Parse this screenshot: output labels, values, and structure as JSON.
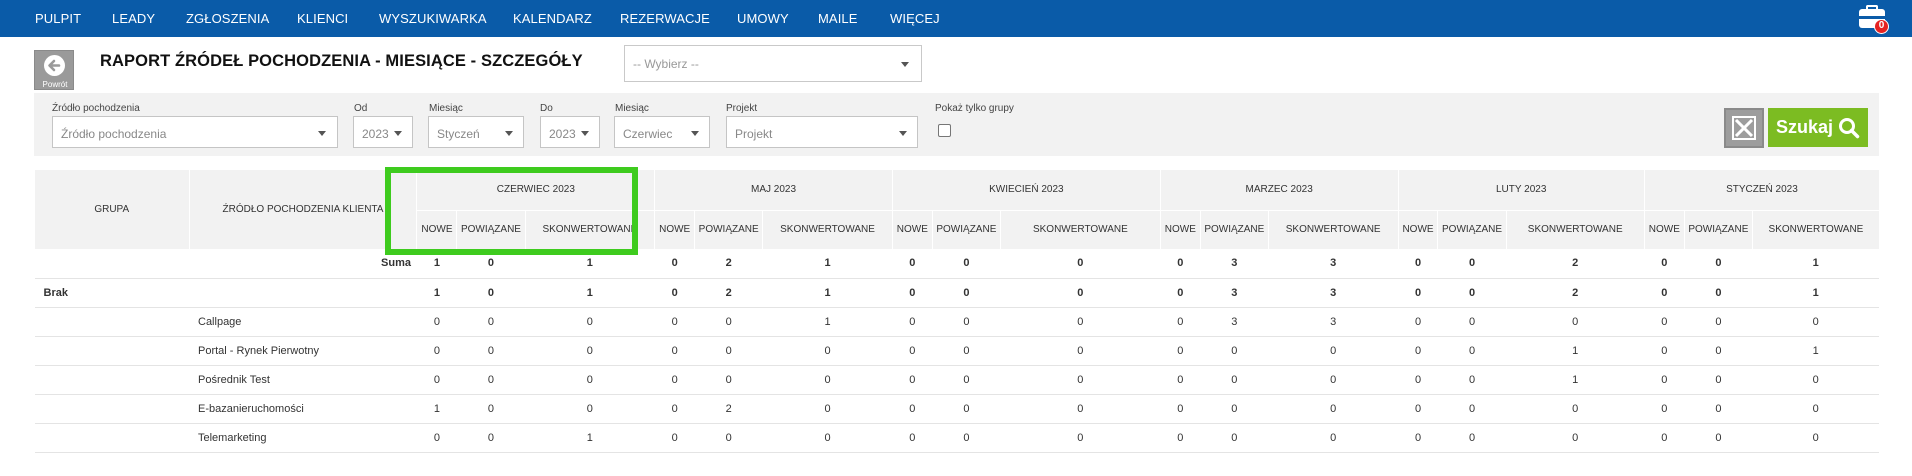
{
  "nav": {
    "items": [
      "PULPIT",
      "LEADY",
      "ZGŁOSZENIA",
      "KLIENCI",
      "WYSZUKIWARKA",
      "KALENDARZ",
      "REZERWACJE",
      "UMOWY",
      "MAILE",
      "WIĘCEJ"
    ],
    "bag_icon": "briefcase-icon",
    "bag_badge": "0"
  },
  "header": {
    "back_label": "Powrót",
    "title": "RAPORT ŹRÓDEŁ POCHODZENIA - MIESIĄCE - SZCZEGÓŁY",
    "select_placeholder": "-- Wybierz --"
  },
  "filters": {
    "source": {
      "label": "Źródło pochodzenia",
      "value": "Źródło pochodzenia"
    },
    "from_year": {
      "label": "Od",
      "value": "2023"
    },
    "from_month": {
      "label": "Miesiąc",
      "value": "Styczeń"
    },
    "to_year": {
      "label": "Do",
      "value": "2023"
    },
    "to_month": {
      "label": "Miesiąc",
      "value": "Czerwiec"
    },
    "project": {
      "label": "Projekt",
      "value": "Projekt"
    },
    "groups_only": {
      "label": "Pokaż tylko grupy",
      "checked": false
    },
    "search_label": "Szukaj"
  },
  "table": {
    "col_group": "GRUPA",
    "col_source": "ŹRÓDŁO POCHODZENIA KLIENTA",
    "months": [
      "CZERWIEC 2023",
      "MAJ 2023",
      "KWIECIEŃ 2023",
      "MARZEC 2023",
      "LUTY 2023",
      "STYCZEŃ 2023"
    ],
    "sub": [
      "NOWE",
      "POWIĄZANE",
      "SKONWERTOWANE"
    ],
    "rows": [
      {
        "type": "sum",
        "group": "",
        "source": "Suma",
        "values": [
          "1",
          "0",
          "1",
          "0",
          "2",
          "1",
          "0",
          "0",
          "0",
          "0",
          "3",
          "3",
          "0",
          "0",
          "2",
          "0",
          "0",
          "1"
        ]
      },
      {
        "type": "group",
        "group": "Brak",
        "source": "",
        "values": [
          "1",
          "0",
          "1",
          "0",
          "2",
          "1",
          "0",
          "0",
          "0",
          "0",
          "3",
          "3",
          "0",
          "0",
          "2",
          "0",
          "0",
          "1"
        ]
      },
      {
        "type": "item",
        "group": "",
        "source": "Callpage",
        "values": [
          "0",
          "0",
          "0",
          "0",
          "0",
          "1",
          "0",
          "0",
          "0",
          "0",
          "3",
          "3",
          "0",
          "0",
          "0",
          "0",
          "0",
          "0"
        ]
      },
      {
        "type": "item",
        "group": "",
        "source": "Portal - Rynek Pierwotny",
        "values": [
          "0",
          "0",
          "0",
          "0",
          "0",
          "0",
          "0",
          "0",
          "0",
          "0",
          "0",
          "0",
          "0",
          "0",
          "1",
          "0",
          "0",
          "1"
        ]
      },
      {
        "type": "item",
        "group": "",
        "source": "Pośrednik Test",
        "values": [
          "0",
          "0",
          "0",
          "0",
          "0",
          "0",
          "0",
          "0",
          "0",
          "0",
          "0",
          "0",
          "0",
          "0",
          "1",
          "0",
          "0",
          "0"
        ]
      },
      {
        "type": "item",
        "group": "",
        "source": "E-bazanieruchomości",
        "values": [
          "1",
          "0",
          "0",
          "0",
          "2",
          "0",
          "0",
          "0",
          "0",
          "0",
          "0",
          "0",
          "0",
          "0",
          "0",
          "0",
          "0",
          "0"
        ]
      },
      {
        "type": "item",
        "group": "",
        "source": "Telemarketing",
        "values": [
          "0",
          "0",
          "1",
          "0",
          "0",
          "0",
          "0",
          "0",
          "0",
          "0",
          "0",
          "0",
          "0",
          "0",
          "0",
          "0",
          "0",
          "0"
        ]
      }
    ]
  },
  "colors": {
    "nav": "#0a5ba8",
    "search": "#7cbc22",
    "highlight": "#3ecb1e",
    "badge": "#e52222"
  }
}
